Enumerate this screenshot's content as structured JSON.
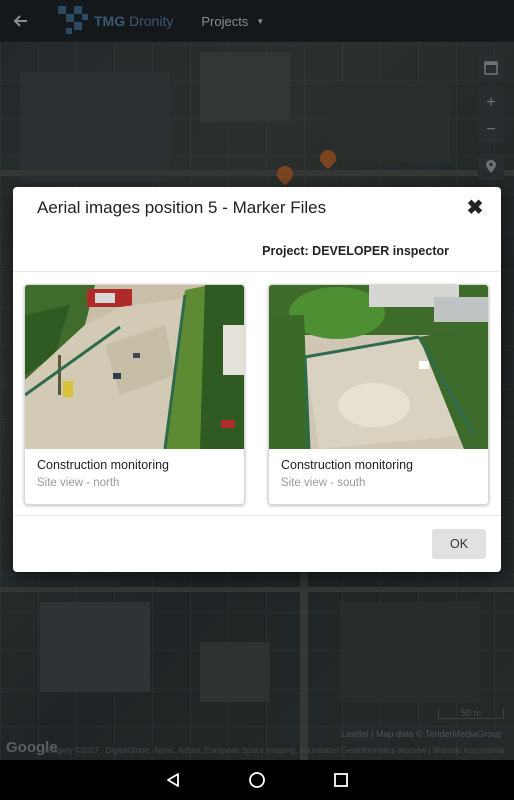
{
  "app_bar": {
    "back_icon": "arrow-left-icon",
    "brand_name_bold": "TMG",
    "brand_name_rest": " Dronity",
    "projects_label": "Projects",
    "projects_caret_icon": "caret-down-icon",
    "brand_color": "#3d5870"
  },
  "map": {
    "controls": [
      "layers-icon",
      "zoom-in-icon",
      "zoom-out-icon",
      "location-icon"
    ],
    "zoom_in_glyph": "+",
    "zoom_out_glyph": "−",
    "google_logo": "Google",
    "attribution": "Leaflet | Map data © TenderMediaGroup",
    "copyright": "Imagery ©2017 , DigitalGlobe, Aerial, Airbus, European Space Imaging, Foundation Geoinformatics Warsaw | Warunki korzystania",
    "scale_label": "50 m"
  },
  "dialog": {
    "title": "Aerial images position 5 - Marker Files",
    "close_icon": "close-icon",
    "close_glyph": "✖",
    "project_label": "Project:",
    "project_name": " DEVELOPER inspector",
    "files": [
      {
        "title": "Construction monitoring",
        "subtitle": "Site view - north"
      },
      {
        "title": "Construction monitoring",
        "subtitle": "Site view - south"
      }
    ],
    "ok_label": "OK"
  },
  "system_nav": {
    "buttons": [
      "back-triangle-icon",
      "home-circle-icon",
      "recents-square-icon"
    ]
  }
}
